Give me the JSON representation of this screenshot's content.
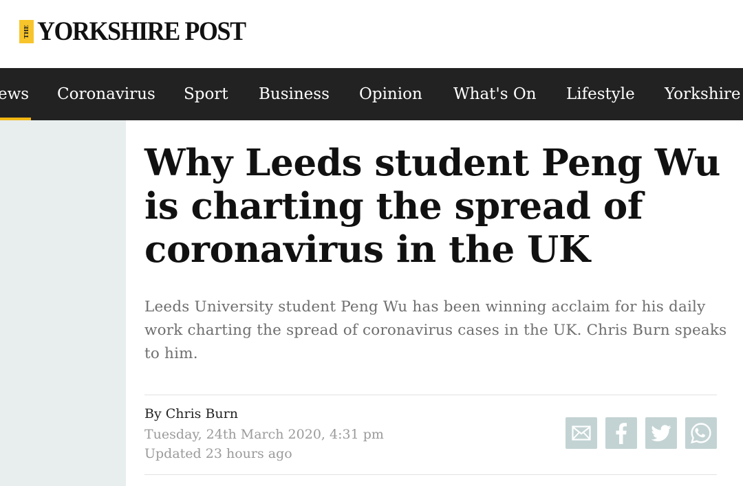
{
  "header": {
    "logo_small": "THE",
    "logo_text": "YORKSHIRE POST"
  },
  "nav": {
    "items": [
      {
        "label": "ews"
      },
      {
        "label": "Coronavirus"
      },
      {
        "label": "Sport"
      },
      {
        "label": "Business"
      },
      {
        "label": "Opinion"
      },
      {
        "label": "What's On"
      },
      {
        "label": "Lifestyle"
      },
      {
        "label": "Yorkshire"
      }
    ]
  },
  "article": {
    "headline": "Why Leeds student Peng Wu is charting the spread of coronavirus in the UK",
    "standfirst": "Leeds University student Peng Wu has been winning acclaim for his daily work charting the spread of coronavirus cases in the UK. Chris Burn speaks to him.",
    "byline": "By Chris Burn",
    "date": "Tuesday, 24th March 2020, 4:31 pm",
    "updated": "Updated  23 hours ago"
  },
  "share": {
    "icons": [
      "email-icon",
      "facebook-icon",
      "twitter-icon",
      "whatsapp-icon"
    ]
  },
  "colors": {
    "nav_bg": "#222222",
    "nav_accent": "#f2b713",
    "logo_accent": "#f7c52b",
    "page_bg": "#e8edee",
    "share_bg": "#c3d3d3"
  }
}
